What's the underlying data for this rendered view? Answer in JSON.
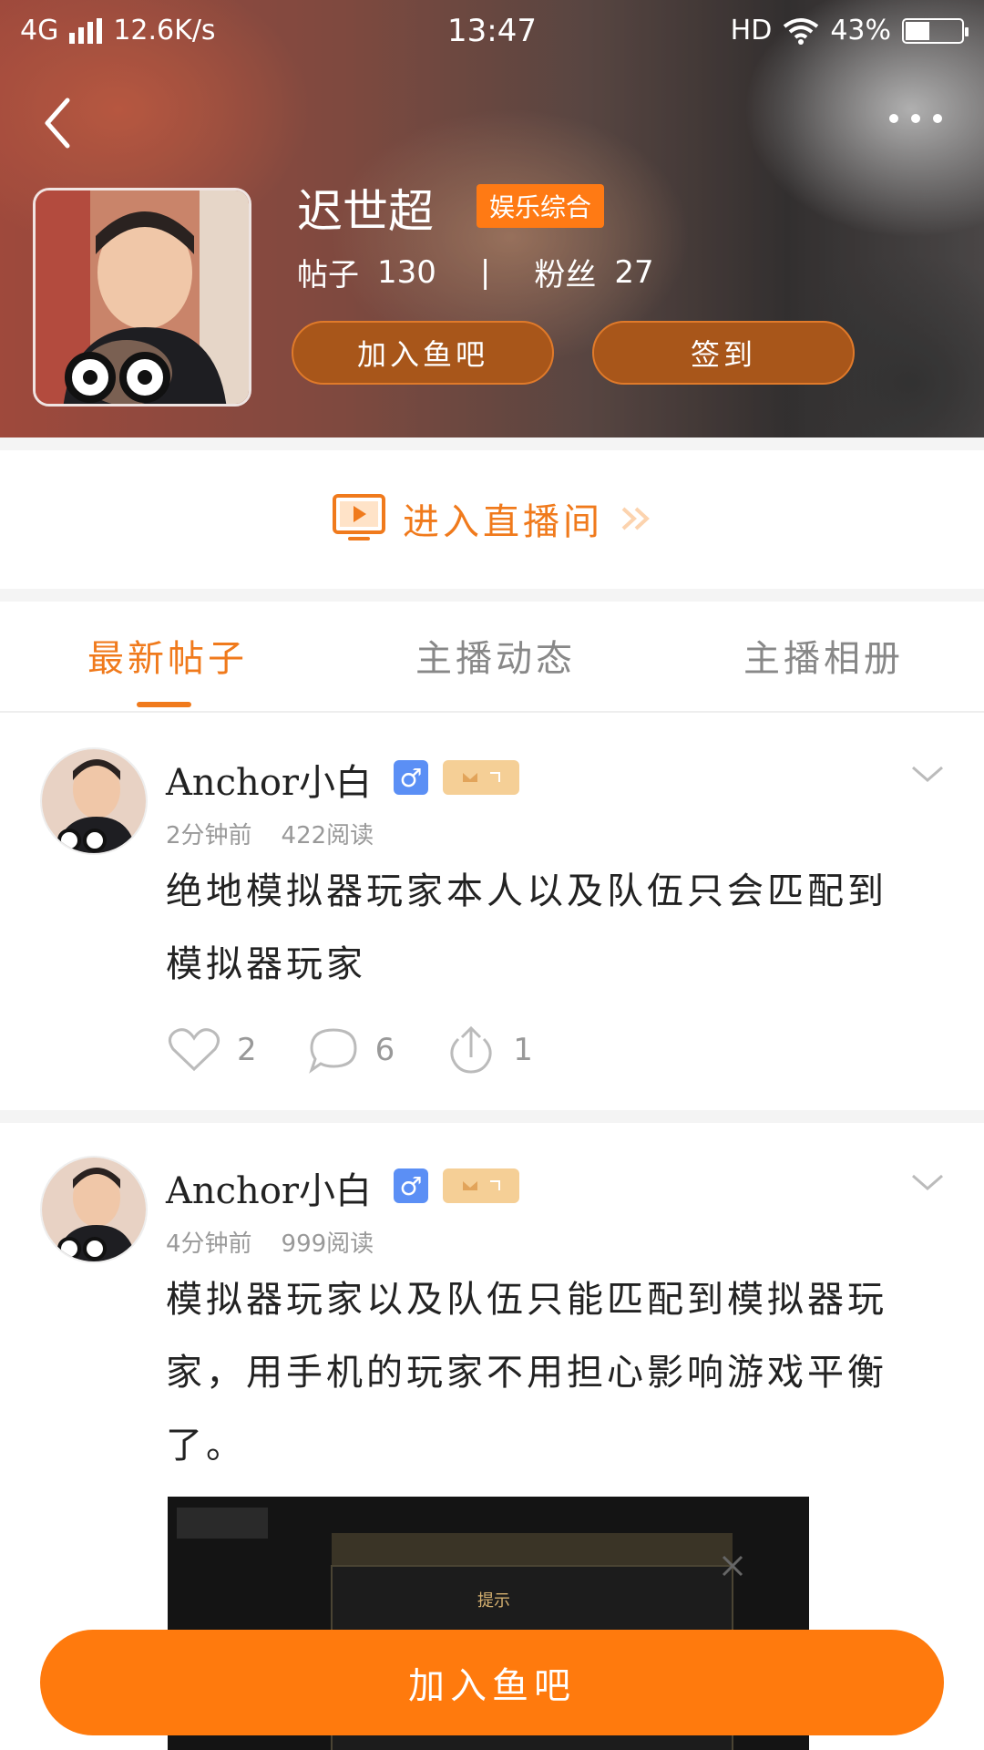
{
  "status_bar": {
    "network": "4G",
    "speed": "12.6K/s",
    "time": "13:47",
    "hd": "HD",
    "battery": "43%",
    "battery_level": 0.43
  },
  "profile": {
    "name": "迟世超",
    "category": "娱乐综合",
    "posts_label": "帖子",
    "posts_count": "130",
    "separator": "|",
    "fans_label": "粉丝",
    "fans_count": "27",
    "join_label": "加入鱼吧",
    "checkin_label": "签到"
  },
  "live_entry": {
    "label": "进入直播间"
  },
  "tabs": [
    {
      "label": "最新帖子",
      "active": true
    },
    {
      "label": "主播动态",
      "active": false
    },
    {
      "label": "主播相册",
      "active": false
    }
  ],
  "posts": [
    {
      "author": "Anchor小白",
      "gender": "♂",
      "time": "2分钟前",
      "reads": "422阅读",
      "content": "绝地模拟器玩家本人以及队伍只会匹配到模拟器玩家",
      "likes": "2",
      "comments": "6",
      "shares": "1"
    },
    {
      "author": "Anchor小白",
      "gender": "♂",
      "time": "4分钟前",
      "reads": "999阅读",
      "content": "模拟器玩家以及队伍只能匹配到模拟器玩家，用手机的玩家不用担心影响游戏平衡了。",
      "image_dialog_label": "提示"
    }
  ],
  "bottom_button": {
    "label": "加入鱼吧"
  },
  "colors": {
    "accent": "#f07a1c",
    "button": "#ff7a0d",
    "gender": "#5b8ff5",
    "level": "#f5cf96"
  }
}
